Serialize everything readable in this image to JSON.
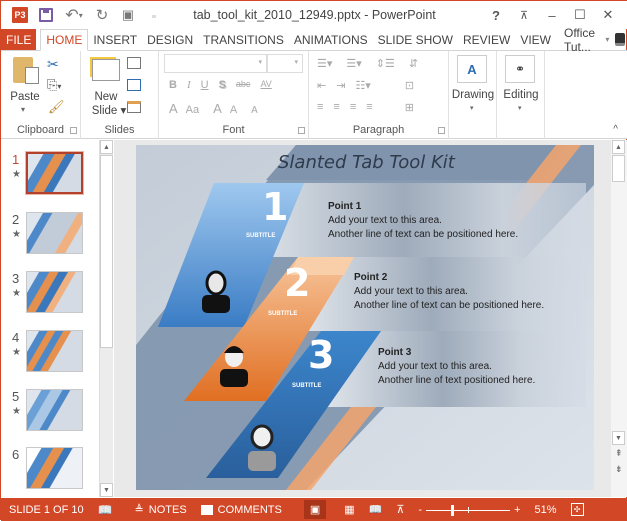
{
  "window": {
    "title": "tab_tool_kit_2010_12949.pptx - PowerPoint",
    "app_icon": "P3",
    "help": "?",
    "restore_ribbon": "⊼",
    "minimize": "–",
    "maximize": "☐",
    "close": "✕"
  },
  "qat": {
    "undo": "↶",
    "undo_drop": "▾",
    "redo": "↻",
    "start": "▣",
    "customize": "₌"
  },
  "tabs": [
    {
      "label": "FILE"
    },
    {
      "label": "HOME"
    },
    {
      "label": "INSERT"
    },
    {
      "label": "DESIGN"
    },
    {
      "label": "TRANSITIONS"
    },
    {
      "label": "ANIMATIONS"
    },
    {
      "label": "SLIDE SHOW"
    },
    {
      "label": "REVIEW"
    },
    {
      "label": "VIEW"
    }
  ],
  "account": {
    "label": "Office Tut...",
    "arrow": "▾"
  },
  "ribbon": {
    "clipboard": {
      "label": "Clipboard",
      "paste": "Paste",
      "paste_arrow": "▾"
    },
    "slides": {
      "label": "Slides",
      "new_slide_1": "New",
      "new_slide_2": "Slide ▾"
    },
    "font": {
      "label": "Font",
      "font_name": "",
      "font_size": "",
      "bold": "B",
      "italic": "I",
      "underline": "U",
      "shadow": "S",
      "strike": "abc",
      "spacing": "AV",
      "color": "A",
      "case": "Aa",
      "grow": "A",
      "shrink": "A",
      "clear": "A"
    },
    "paragraph": {
      "label": "Paragraph"
    },
    "drawing": {
      "label": "Drawing",
      "arrow": "▾"
    },
    "editing": {
      "label": "Editing",
      "arrow": "▾"
    },
    "collapse": "^"
  },
  "thumbnails": [
    {
      "num": "1",
      "star": "★",
      "selected": true
    },
    {
      "num": "2",
      "star": "★"
    },
    {
      "num": "3",
      "star": "★"
    },
    {
      "num": "4",
      "star": "★"
    },
    {
      "num": "5",
      "star": "★"
    },
    {
      "num": "6",
      "star": ""
    }
  ],
  "slide": {
    "title": "Slanted Tab Tool Kit",
    "points": [
      {
        "num": "1",
        "subtitle": "SUBTITLE",
        "heading": "Point 1",
        "line1": "Add your text to this area.",
        "line2": "Another line of text can be positioned here."
      },
      {
        "num": "2",
        "subtitle": "SUBTITLE",
        "heading": "Point 2",
        "line1": "Add your text to this area.",
        "line2": "Another line of text can be positioned here."
      },
      {
        "num": "3",
        "subtitle": "SUBTITLE",
        "heading": "Point 3",
        "line1": "Add your text to this area.",
        "line2": "Another line of text positioned here."
      }
    ],
    "colors": {
      "blue": "#3a7cc4",
      "orange": "#e8803a",
      "steel": "#7e93ad",
      "bg": "#d4dbe5"
    }
  },
  "status": {
    "slide_counter": "SLIDE 1 OF 10",
    "notes": "NOTES",
    "comments": "COMMENTS",
    "zoom_minus": "-",
    "zoom_plus": "+",
    "zoom_level": "51%"
  }
}
